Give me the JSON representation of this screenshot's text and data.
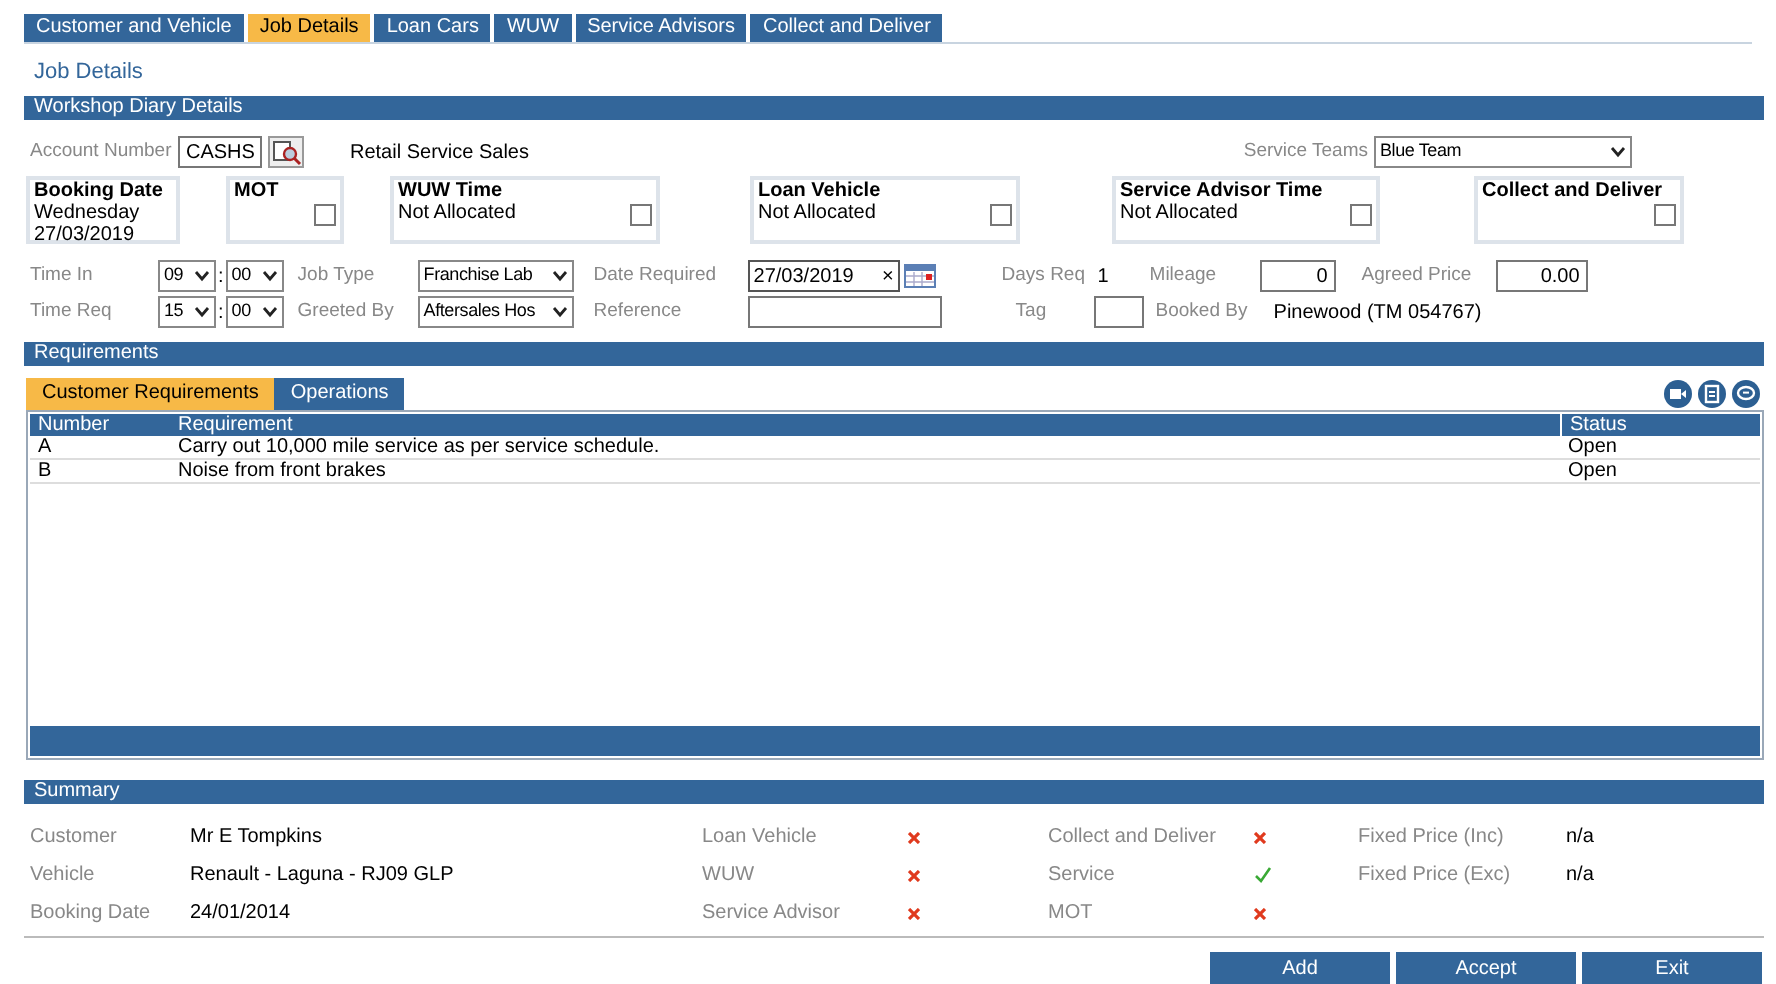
{
  "tabs": [
    {
      "label": "Customer and Vehicle",
      "selected": false
    },
    {
      "label": "Job Details",
      "selected": true
    },
    {
      "label": "Loan Cars",
      "selected": false
    },
    {
      "label": "WUW",
      "selected": false
    },
    {
      "label": "Service Advisors",
      "selected": false
    },
    {
      "label": "Collect and Deliver",
      "selected": false
    }
  ],
  "page_title": "Job Details",
  "workshop": {
    "title": "Workshop Diary Details",
    "account_number": {
      "label": "Account Number",
      "value": "CASHS"
    },
    "account_name": "Retail Service Sales",
    "service_teams": {
      "label": "Service Teams",
      "value": "Blue Team"
    },
    "booking": {
      "title": "Booking Date",
      "day": "Wednesday",
      "date": "27/03/2019"
    },
    "allocations": [
      {
        "title": "MOT",
        "checked": false
      },
      {
        "title": "WUW Time",
        "status": "Not Allocated",
        "checked": false
      },
      {
        "title": "Loan Vehicle",
        "status": "Not Allocated",
        "checked": false
      },
      {
        "title": "Service Advisor Time",
        "status": "Not Allocated",
        "checked": false
      },
      {
        "title": "Collect and Deliver",
        "checked": false
      }
    ],
    "time_in": {
      "label": "Time In",
      "hour": "09",
      "separator": ":",
      "minute": "00"
    },
    "time_req": {
      "label": "Time Req",
      "hour": "15",
      "separator": ":",
      "minute": "00"
    },
    "job_type": {
      "label": "Job Type",
      "value": "Franchise Lab"
    },
    "greeted_by": {
      "label": "Greeted By",
      "value": "Aftersales Hos"
    },
    "date_required": {
      "label": "Date Required",
      "value": "27/03/2019",
      "clear": "×"
    },
    "reference": {
      "label": "Reference"
    },
    "days_req": {
      "label": "Days Req",
      "value": "1"
    },
    "tag": {
      "label": "Tag"
    },
    "mileage": {
      "label": "Mileage",
      "value": "0"
    },
    "booked_by": {
      "label": "Booked By",
      "value": "Pinewood (TM 054767)"
    },
    "agreed_price": {
      "label": "Agreed Price",
      "value": "0.00"
    }
  },
  "requirements": {
    "title": "Requirements",
    "tabs": [
      {
        "label": "Customer Requirements",
        "selected": true
      },
      {
        "label": "Operations",
        "selected": false
      }
    ],
    "columns": [
      "Number",
      "Requirement",
      "Status"
    ],
    "rows": [
      {
        "number": "A",
        "requirement": "Carry out 10,000 mile service as per service schedule.",
        "status": "Open"
      },
      {
        "number": "B",
        "requirement": "Noise from front brakes",
        "status": "Open"
      }
    ]
  },
  "summary": {
    "title": "Summary",
    "details": [
      {
        "label": "Customer",
        "value": "Mr E Tompkins"
      },
      {
        "label": "Vehicle",
        "value": "Renault - Laguna - RJ09 GLP"
      },
      {
        "label": "Booking Date",
        "value": "24/01/2014"
      }
    ],
    "checks_left": [
      {
        "label": "Loan Vehicle",
        "done": false
      },
      {
        "label": "WUW",
        "done": false
      },
      {
        "label": "Service Advisor",
        "done": false
      }
    ],
    "checks_right": [
      {
        "label": "Collect and Deliver",
        "done": false
      },
      {
        "label": "Service",
        "done": true
      },
      {
        "label": "MOT",
        "done": false
      }
    ],
    "prices": [
      {
        "label": "Fixed Price (Inc)",
        "value": "n/a"
      },
      {
        "label": "Fixed Price (Exc)",
        "value": "n/a"
      }
    ]
  },
  "buttons": [
    "Add",
    "Accept",
    "Exit"
  ]
}
